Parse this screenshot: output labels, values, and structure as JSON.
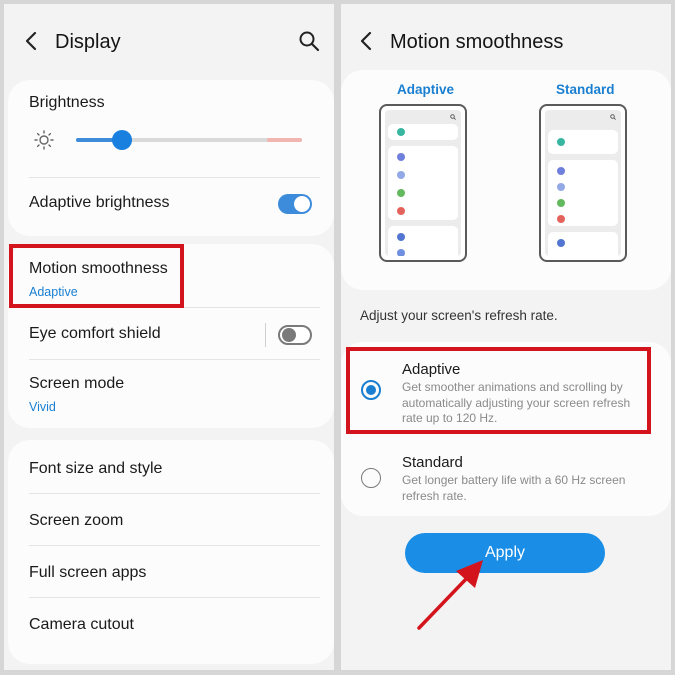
{
  "left": {
    "title": "Display",
    "brightness": {
      "label": "Brightness",
      "level": 0.15
    },
    "adaptive_brightness": {
      "label": "Adaptive brightness",
      "on": true
    },
    "motion_smoothness": {
      "label": "Motion smoothness",
      "value": "Adaptive"
    },
    "eye_comfort": {
      "label": "Eye comfort shield",
      "on": false
    },
    "screen_mode": {
      "label": "Screen mode",
      "value": "Vivid"
    },
    "font_size": "Font size and style",
    "screen_zoom": "Screen zoom",
    "full_screen": "Full screen apps",
    "camera_cutout": "Camera cutout"
  },
  "right": {
    "title": "Motion smoothness",
    "preview": {
      "adaptive_label": "Adaptive",
      "standard_label": "Standard"
    },
    "caption": "Adjust your screen's refresh rate.",
    "options": [
      {
        "title": "Adaptive",
        "desc": "Get smoother animations and scrolling by automatically adjusting your screen refresh rate up to 120 Hz.",
        "selected": true
      },
      {
        "title": "Standard",
        "desc": "Get longer battery life with a 60 Hz screen refresh rate.",
        "selected": false
      }
    ],
    "apply_label": "Apply"
  },
  "colors": {
    "accent": "#1a7fd1",
    "highlight": "#d4141c",
    "toggle_on": "#3d8bdb",
    "apply": "#1a8de6"
  },
  "icons": [
    "chevron-left-icon",
    "search-icon",
    "sun-icon",
    "arrow-icon"
  ]
}
